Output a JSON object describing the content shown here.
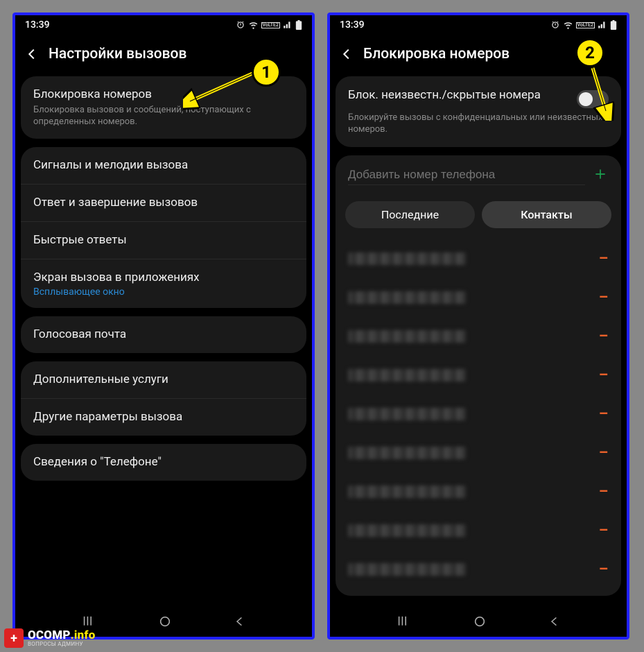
{
  "status": {
    "time": "13:39"
  },
  "left": {
    "title": "Настройки вызовов",
    "group1_item_title": "Блокировка номеров",
    "group1_item_sub": "Блокировка вызовов и сообщений, поступающих с определенных номеров.",
    "group2_items": [
      "Сигналы и мелодии вызова",
      "Ответ и завершение вызовов",
      "Быстрые ответы"
    ],
    "group2_last_title": "Экран вызова в приложениях",
    "group2_last_link": "Всплывающее окно",
    "group3_item": "Голосовая почта",
    "group4_items": [
      "Дополнительные услуги",
      "Другие параметры вызова"
    ],
    "group5_item": "Сведения о \"Телефоне\""
  },
  "right": {
    "title": "Блокировка номеров",
    "toggle_title": "Блок. неизвестн./скрытые номера",
    "toggle_sub": "Блокируйте вызовы с конфиденциальных или неизвестных номеров.",
    "input_placeholder": "Добавить номер телефона",
    "chip_recent": "Последние",
    "chip_contacts": "Контакты",
    "blocked_count": 9
  },
  "callouts": {
    "one": "1",
    "two": "2"
  },
  "watermark": {
    "badge": "+",
    "title_a": "OCOMP",
    "title_b": ".info",
    "sub": "ВОПРОСЫ АДМИНУ"
  }
}
